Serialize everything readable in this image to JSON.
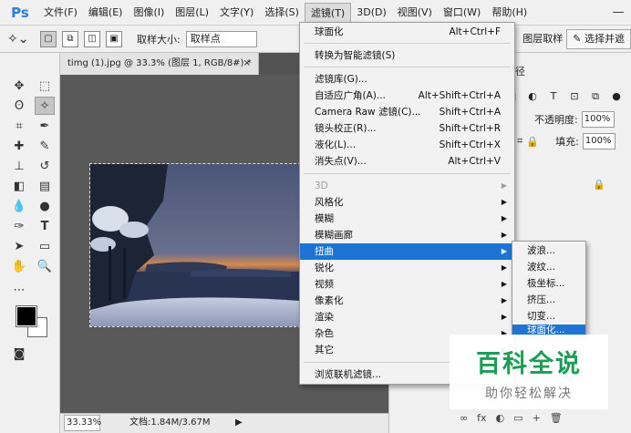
{
  "app": {
    "logo": "Ps"
  },
  "menubar": {
    "items": [
      "文件(F)",
      "编辑(E)",
      "图像(I)",
      "图层(L)",
      "文字(Y)",
      "选择(S)",
      "滤镜(T)",
      "3D(D)",
      "视图(V)",
      "窗口(W)",
      "帮助(H)"
    ],
    "active_index": 6,
    "window_controls": [
      "—",
      "☐",
      "✕"
    ]
  },
  "options": {
    "sample_size_label": "取样大小:",
    "sample_size_value": "取样点",
    "sample_all_layers": "图层取样",
    "select_and_mask": "选择并遮"
  },
  "document": {
    "tab_title": "timg (1).jpg @ 33.3% (图层 1, RGB/8#) *",
    "tab_close": "×",
    "zoom": "33.33%",
    "doc_info": "文档:1.84M/3.67M",
    "status_arrow": "▶"
  },
  "filter_menu": {
    "items": [
      {
        "label": "球面化",
        "shortcut": "Alt+Ctrl+F"
      },
      {
        "label": "转换为智能滤镜(S)"
      },
      {
        "label": "滤镜库(G)..."
      },
      {
        "label": "自适应广角(A)...",
        "shortcut": "Alt+Shift+Ctrl+A"
      },
      {
        "label": "Camera Raw 滤镜(C)...",
        "shortcut": "Shift+Ctrl+A"
      },
      {
        "label": "镜头校正(R)...",
        "shortcut": "Shift+Ctrl+R"
      },
      {
        "label": "液化(L)...",
        "shortcut": "Shift+Ctrl+X"
      },
      {
        "label": "消失点(V)...",
        "shortcut": "Alt+Ctrl+V"
      },
      {
        "label": "3D",
        "submenu": true,
        "disabled": true
      },
      {
        "label": "风格化",
        "submenu": true
      },
      {
        "label": "模糊",
        "submenu": true
      },
      {
        "label": "模糊画廊",
        "submenu": true
      },
      {
        "label": "扭曲",
        "submenu": true,
        "highlighted": true
      },
      {
        "label": "锐化",
        "submenu": true
      },
      {
        "label": "视频",
        "submenu": true
      },
      {
        "label": "像素化",
        "submenu": true
      },
      {
        "label": "渲染",
        "submenu": true
      },
      {
        "label": "杂色",
        "submenu": true
      },
      {
        "label": "其它",
        "submenu": true
      },
      {
        "label": "浏览联机滤镜..."
      }
    ],
    "submenu_arrow": "▶"
  },
  "distort_submenu": {
    "items": [
      "波浪...",
      "波纹...",
      "极坐标...",
      "挤压...",
      "切变...",
      "球面化..."
    ],
    "highlighted_index": 5
  },
  "layers_panel": {
    "tab_fragment": "路径",
    "opacity_label": "不透明度:",
    "opacity_value": "100%",
    "fill_label": "填充:",
    "fill_value": "100%",
    "layer_name_fragment": "1",
    "lock_icon": "🔒",
    "bottom_icons": [
      "∞",
      "fx",
      "◐",
      "▭",
      "+",
      "🗑"
    ]
  },
  "watermark": {
    "title": "百科全说",
    "subtitle": "助你轻松解决"
  },
  "colors": {
    "accent_highlight": "#1e74d2",
    "watermark_green": "#1c9d56",
    "workspace_gray": "#535353",
    "panel_bg": "#f0f0f0"
  }
}
